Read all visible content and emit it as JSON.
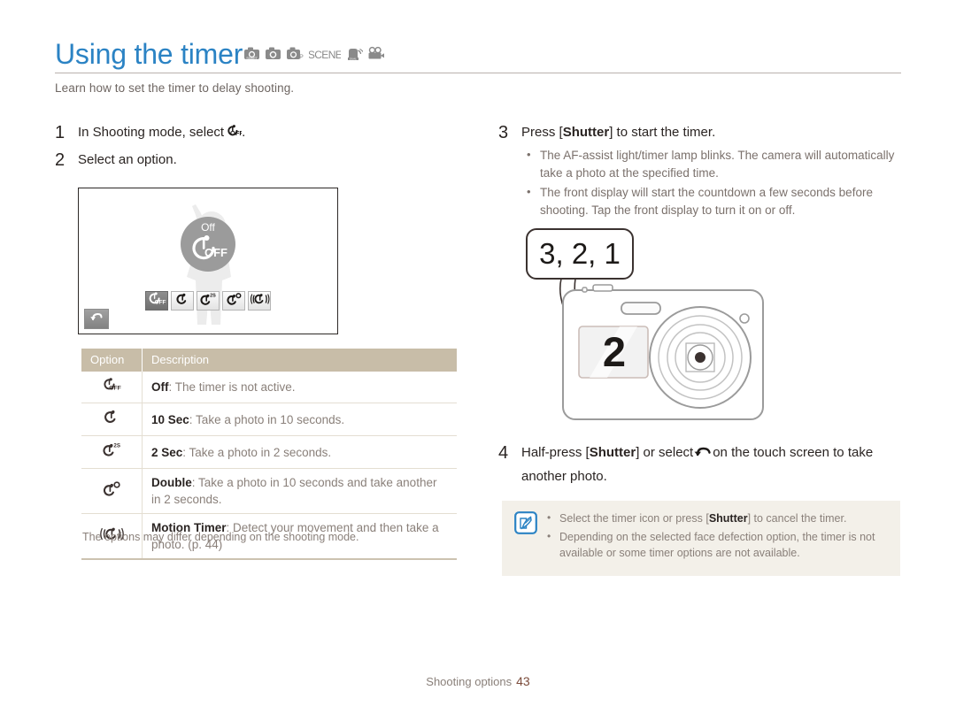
{
  "header": {
    "title": "Using the timer",
    "subtitle": "Learn how to set the timer to delay shooting.",
    "mode_icons": [
      "smart-auto-icon",
      "camera-auto-icon",
      "program-mode-icon",
      "scene-mode-icon",
      "dual-is-icon",
      "movie-mode-icon"
    ]
  },
  "steps": {
    "one": {
      "num": "1",
      "text_before": "In Shooting mode, select",
      "icon": "timer-off-icon",
      "text_after": "."
    },
    "two": {
      "num": "2",
      "text": "Select an option."
    },
    "three": {
      "num": "3",
      "text_pre": "Press [",
      "text_bold": "Shutter",
      "text_post": "] to start the timer.",
      "bullets": [
        "The AF-assist light/timer lamp blinks. The camera will automatically take a photo at the specified time.",
        "The front display will start the countdown a few seconds before shooting. Tap the front display to turn it on or off."
      ]
    },
    "four": {
      "num": "4",
      "text_pre": "Half-press [",
      "text_bold": "Shutter",
      "text_mid": "] or select",
      "icon": "touch-shutter-icon",
      "text_post": "on the touch screen to take another photo."
    }
  },
  "camera_screen": {
    "bubble_label": "Off",
    "bubble_glyph": "timer-off-icon",
    "back_button": "back-arrow-icon",
    "options": [
      {
        "name": "timer-off-icon",
        "selected": true
      },
      {
        "name": "timer-10sec-icon",
        "selected": false
      },
      {
        "name": "timer-2sec-icon",
        "selected": false
      },
      {
        "name": "timer-double-icon",
        "selected": false
      },
      {
        "name": "timer-motion-icon",
        "selected": false
      }
    ]
  },
  "table": {
    "headers": [
      "Option",
      "Description"
    ],
    "rows": [
      {
        "icon": "timer-off-icon",
        "bold": "Off",
        "text": ": The timer is not active."
      },
      {
        "icon": "timer-10sec-icon",
        "bold": "10 Sec",
        "text": ": Take a photo in 10 seconds."
      },
      {
        "icon": "timer-2sec-icon",
        "bold": "2 Sec",
        "text": ": Take a photo in 2 seconds."
      },
      {
        "icon": "timer-double-icon",
        "bold": "Double",
        "text": ": Take a photo in 10 seconds and take another in 2 seconds."
      },
      {
        "icon": "timer-motion-icon",
        "bold": "Motion Timer",
        "text": ": Detect your movement and then take a photo. (p. 44)"
      }
    ],
    "footnote": "The options may differ depending on the shooting mode."
  },
  "illustration": {
    "callout_text": "3, 2, 1",
    "front_display_text": "2"
  },
  "note": {
    "icon": "note-pen-icon",
    "items": [
      {
        "pre": "Select the timer icon or press [",
        "bold": "Shutter",
        "post": "] to cancel the timer."
      },
      {
        "pre": "Depending on the selected face defection option, the timer is not available or some timer options are not available.",
        "bold": "",
        "post": ""
      }
    ]
  },
  "footer": {
    "section": "Shooting options",
    "page_number": "43"
  },
  "colors": {
    "title_blue": "#2b83c4",
    "table_header_tan": "#c8bda8",
    "note_bg": "#f3f0e9",
    "body_text": "#2a2422",
    "muted_text": "#8a807a",
    "page_number": "#7b4b3a"
  }
}
